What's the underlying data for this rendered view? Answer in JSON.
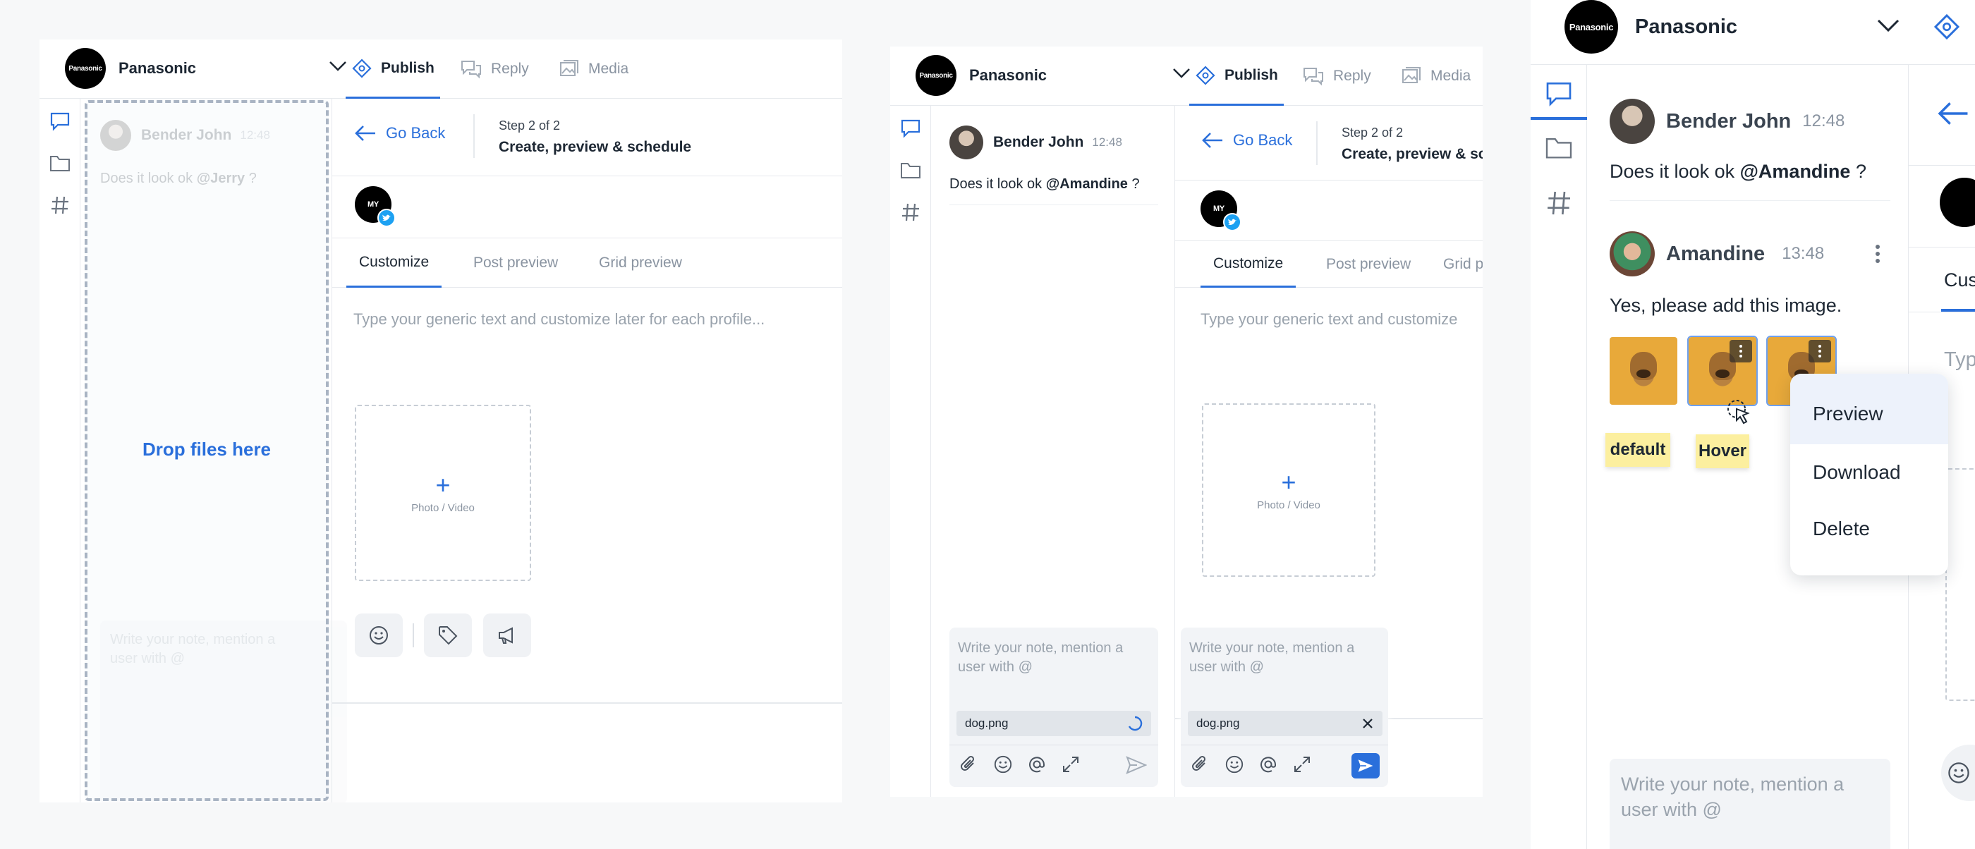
{
  "brand": "Panasonic",
  "brand_logo_text": "Panasonic",
  "tabs": {
    "publish": "Publish",
    "reply": "Reply",
    "media": "Media"
  },
  "header": {
    "go_back": "Go Back",
    "step": "Step 2 of 2",
    "step_title": "Create, preview & schedule",
    "step_title_truncated": "Create, preview & sc"
  },
  "subtabs": {
    "customize": "Customize",
    "post_preview": "Post preview",
    "grid_preview": "Grid preview",
    "grid_truncated": "Grid p"
  },
  "composer": {
    "placeholder": "Type your generic text and customize later for each profile...",
    "placeholder_truncated": "Type your generic text and customize",
    "placeholder_short": "Typ"
  },
  "media_box": {
    "plus": "+",
    "label": "Photo / Video"
  },
  "profile_badge": "MY",
  "dropzone": {
    "label": "Drop files here"
  },
  "note": {
    "placeholder": "Write your note, mention a user with @",
    "attachment": "dog.png"
  },
  "messages": {
    "bender": {
      "name": "Bender John",
      "time": "12:48",
      "text_prefix": "Does it look ok ",
      "mention_jerry": "@Jerry",
      "mention_amandine": "@Amandine",
      "suffix": " ?"
    },
    "amandine": {
      "name": "Amandine",
      "time": "13:48",
      "text": "Yes, please add this image."
    }
  },
  "stickies": {
    "default": "default",
    "hover": "Hover"
  },
  "menu": {
    "preview": "Preview",
    "download": "Download",
    "delete": "Delete"
  },
  "colors": {
    "accent": "#2a6fdb",
    "dropzone_border": "#a9b4c3",
    "sticky": "#fcef9f",
    "twitter": "#1da1f2"
  }
}
